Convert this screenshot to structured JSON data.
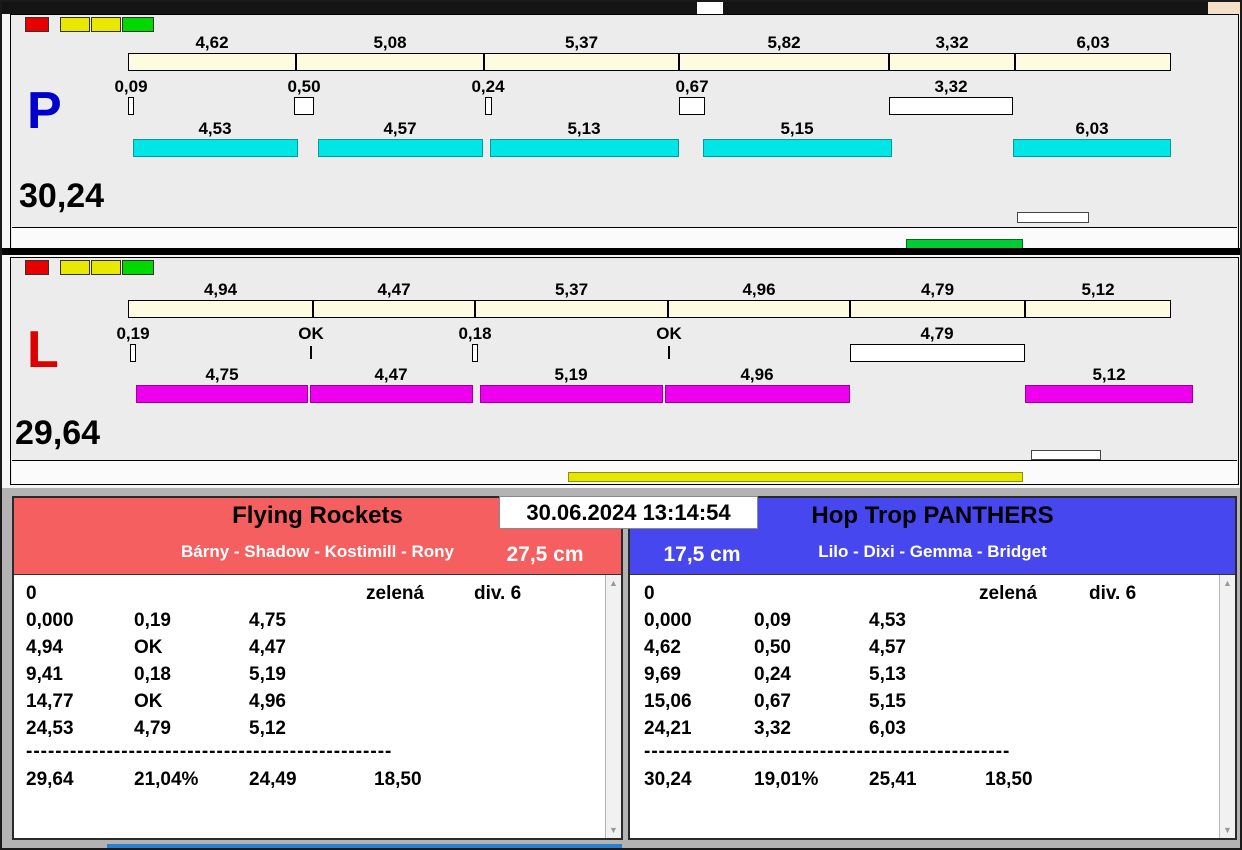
{
  "lanes": {
    "p": {
      "label": "P",
      "total": "30,24",
      "splits": [
        "4,62",
        "5,08",
        "5,37",
        "5,82",
        "3,32",
        "6,03"
      ],
      "changes": [
        "0,09",
        "0,50",
        "0,24",
        "0,67",
        "3,32"
      ],
      "runs": [
        "4,53",
        "4,57",
        "5,13",
        "5,15",
        "6,03"
      ]
    },
    "l": {
      "label": "L",
      "total": "29,64",
      "splits": [
        "4,94",
        "4,47",
        "5,37",
        "4,96",
        "4,79",
        "5,12"
      ],
      "changes": [
        "0,19",
        "OK",
        "0,18",
        "OK",
        "4,79"
      ],
      "runs": [
        "4,75",
        "4,47",
        "5,19",
        "4,96",
        "5,12"
      ]
    }
  },
  "clock": "30.06.2024 13:14:54",
  "teams": {
    "left": {
      "name": "Flying Rockets",
      "lineup": "Bárny - Shadow - Kostimill - Rony",
      "height": "27,5 cm",
      "run_no": "0",
      "card": "zelená",
      "division": "div. 6",
      "rows": [
        [
          "0,000",
          "0,19",
          "4,75"
        ],
        [
          "4,94",
          "OK",
          "4,47"
        ],
        [
          "9,41",
          "0,18",
          "5,19"
        ],
        [
          "14,77",
          "OK",
          "4,96"
        ],
        [
          "24,53",
          "4,79",
          "5,12"
        ]
      ],
      "separator": "--------------------------------------------------",
      "totals": [
        "29,64",
        "21,04%",
        "24,49",
        "18,50"
      ]
    },
    "right": {
      "name": "Hop Trop PANTHERS",
      "lineup": "Lilo - Dixi - Gemma - Bridget",
      "height": "17,5 cm",
      "run_no": "0",
      "card": "zelená",
      "division": "div. 6",
      "rows": [
        [
          "0,000",
          "0,09",
          "4,53"
        ],
        [
          "4,62",
          "0,50",
          "4,57"
        ],
        [
          "9,69",
          "0,24",
          "5,13"
        ],
        [
          "15,06",
          "0,67",
          "5,15"
        ],
        [
          "24,21",
          "3,32",
          "6,03"
        ]
      ],
      "separator": "--------------------------------------------------",
      "totals": [
        "30,24",
        "19,01%",
        "25,41",
        "18,50"
      ]
    }
  },
  "colors": {
    "lane_p_run_bar": "#00e6e6",
    "lane_l_run_bar": "#ee00ee",
    "split_bar": "#fffbe0",
    "lane_p_letter": "#0000cc",
    "lane_l_letter": "#dd0000",
    "progress_green": "#00cc33",
    "progress_yellow": "#e6e600",
    "team_left_header": "#f55f5f",
    "team_right_header": "#4747ef"
  },
  "icons": {
    "scroll_up": "▲",
    "scroll_down": "▼"
  }
}
